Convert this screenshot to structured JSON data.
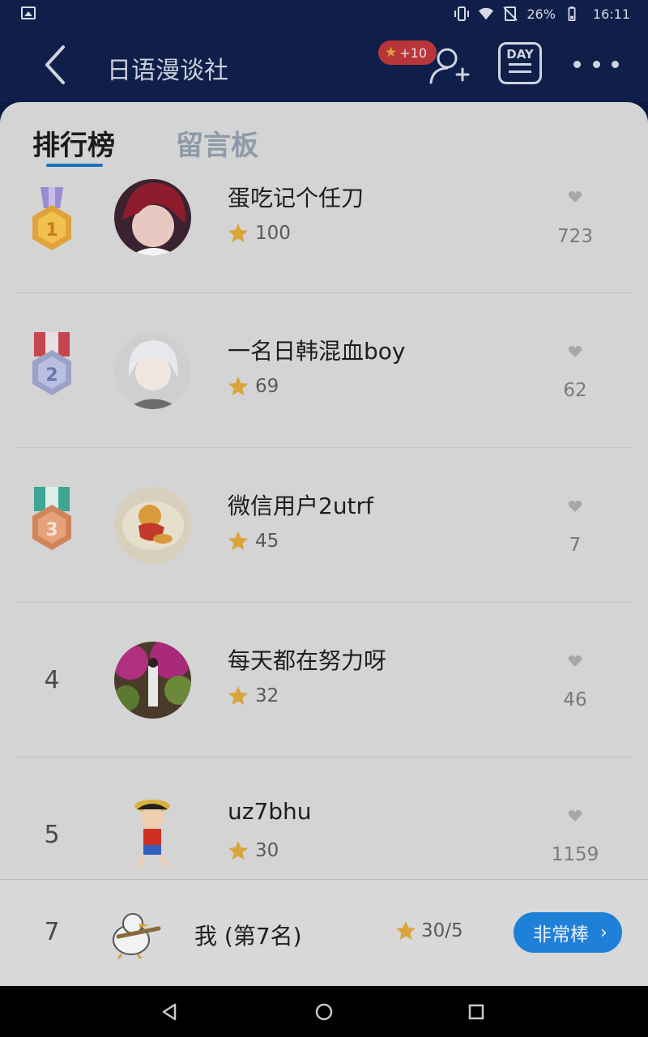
{
  "status_bar": {
    "battery": "26%",
    "time": "16:11"
  },
  "app_bar": {
    "title": "日语漫谈社",
    "points_badge": "+10",
    "day_label": "DAY"
  },
  "tabs": [
    {
      "label": "排行榜",
      "active": true
    },
    {
      "label": "留言板",
      "active": false
    }
  ],
  "ranking": [
    {
      "rank": "1",
      "medal": "gold",
      "name": "蛋吃记个任刀",
      "score": "100",
      "likes": "723"
    },
    {
      "rank": "2",
      "medal": "silver",
      "name": "一名日韩混血boy",
      "score": "69",
      "likes": "62"
    },
    {
      "rank": "3",
      "medal": "bronze",
      "name": "微信用户2utrf",
      "score": "45",
      "likes": "7"
    },
    {
      "rank": "4",
      "medal": null,
      "name": "每天都在努力呀",
      "score": "32",
      "likes": "46"
    },
    {
      "rank": "5",
      "medal": null,
      "name": "uz7bhu",
      "score": "30",
      "likes": "1159"
    }
  ],
  "me": {
    "rank": "7",
    "name": "我 (第7名)",
    "score": "30/5",
    "button_label": "非常棒"
  },
  "colors": {
    "header_bg": "#0f1f4a",
    "accent": "#1e80d6",
    "star": "#d9a53a",
    "badge": "#b8363a"
  }
}
